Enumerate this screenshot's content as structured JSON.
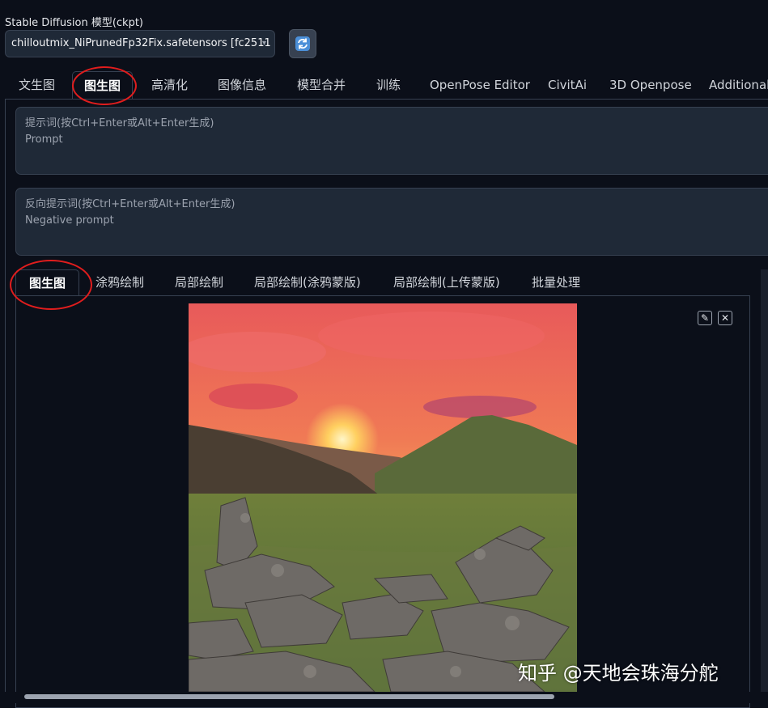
{
  "model": {
    "label": "Stable Diffusion 模型(ckpt)",
    "selected": "chilloutmix_NiPrunedFp32Fix.safetensors [fc2511"
  },
  "top_tabs": [
    "文生图",
    "图生图",
    "高清化",
    "图像信息",
    "模型合并",
    "训练",
    "OpenPose Editor",
    "CivitAi",
    "3D Openpose",
    "Additional"
  ],
  "active_top_tab": "图生图",
  "prompt": {
    "placeholder": "提示词(按Ctrl+Enter或Alt+Enter生成)",
    "sub": "Prompt"
  },
  "negative_prompt": {
    "placeholder": "反向提示词(按Ctrl+Enter或Alt+Enter生成)",
    "sub": "Negative prompt"
  },
  "sub_tabs": [
    "图生图",
    "涂鸦绘制",
    "局部绘制",
    "局部绘制(涂鸦蒙版)",
    "局部绘制(上传蒙版)",
    "批量处理"
  ],
  "active_sub_tab": "图生图",
  "image_tools": {
    "edit_icon": "pencil-icon",
    "close_icon": "close-icon"
  },
  "watermark": "知乎 @天地会珠海分舵",
  "colors": {
    "background": "#0b0f19",
    "highlight_circle": "#e11d1d"
  }
}
